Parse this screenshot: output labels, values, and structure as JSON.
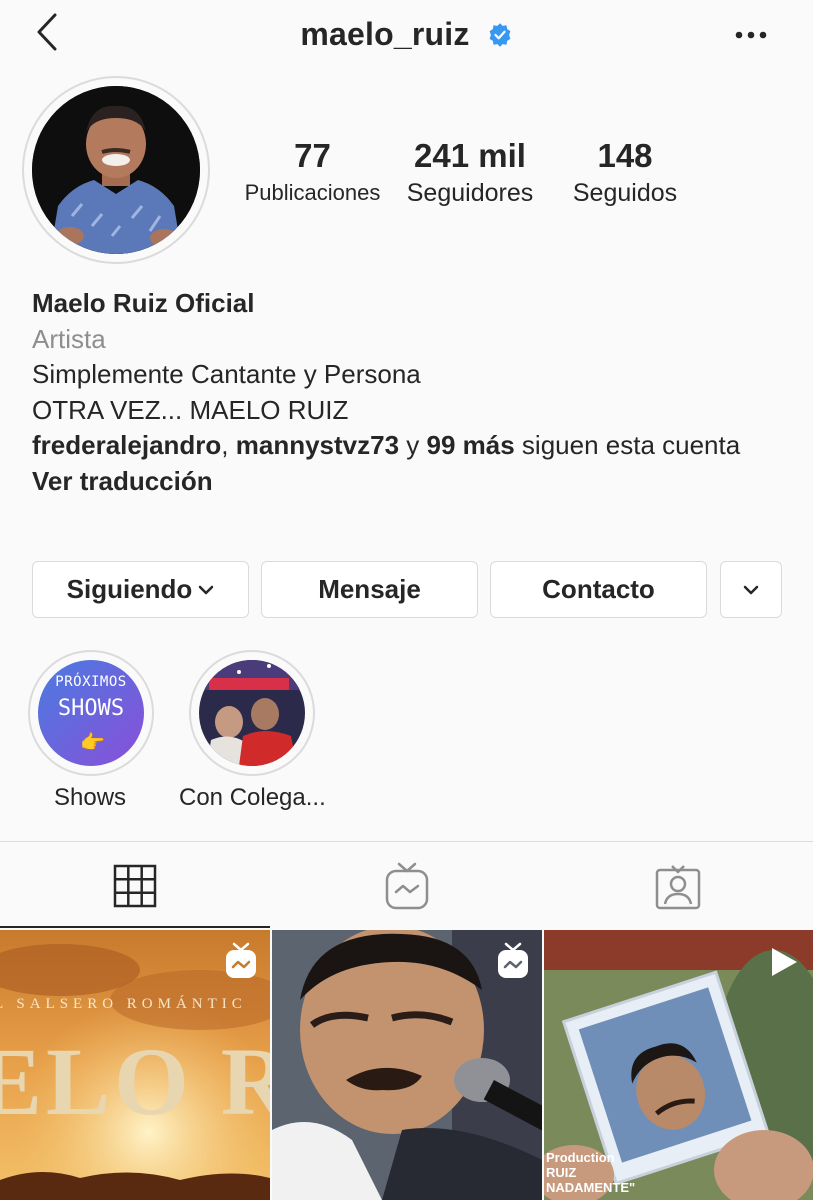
{
  "header": {
    "username": "maelo_ruiz",
    "verified": true,
    "back_icon": "chevron-left-icon",
    "more_icon": "more-horizontal-icon"
  },
  "stats": {
    "posts_count": "77",
    "posts_label": "Publicaciones",
    "followers_count": "241 mil",
    "followers_label": "Seguidores",
    "following_count": "148",
    "following_label": "Seguidos"
  },
  "bio": {
    "name": "Maelo Ruiz Oficial",
    "category": "Artista",
    "line1": "Simplemente Cantante y Persona",
    "line2": "OTRA VEZ... MAELO RUIZ",
    "followed_user1": "frederalejandro",
    "followed_sep": ", ",
    "followed_user2": "mannystvz73",
    "followed_and": " y ",
    "followed_more": "99 más",
    "followed_tail": " siguen esta cuenta",
    "translate": "Ver traducción"
  },
  "actions": {
    "following": "Siguiendo",
    "message": "Mensaje",
    "contact": "Contacto"
  },
  "highlights": [
    {
      "label": "Shows",
      "cover_line1": "PRÓXIMOS",
      "cover_line2": "SHOWS",
      "cover_emoji": "👉"
    },
    {
      "label": "Con Colega..."
    }
  ],
  "posts": [
    {
      "type": "igtv",
      "overlay_line": "L SALSERO ROMÁNTIC",
      "overlay_big": "ELO R"
    },
    {
      "type": "igtv"
    },
    {
      "type": "video",
      "caption1": "Production",
      "caption2": "RUIZ",
      "caption3": "NADAMENTE\""
    }
  ],
  "colors": {
    "verified_blue": "#3897f0",
    "border": "#dbdbdb",
    "muted_text": "#8e8e8e",
    "text": "#262626"
  }
}
